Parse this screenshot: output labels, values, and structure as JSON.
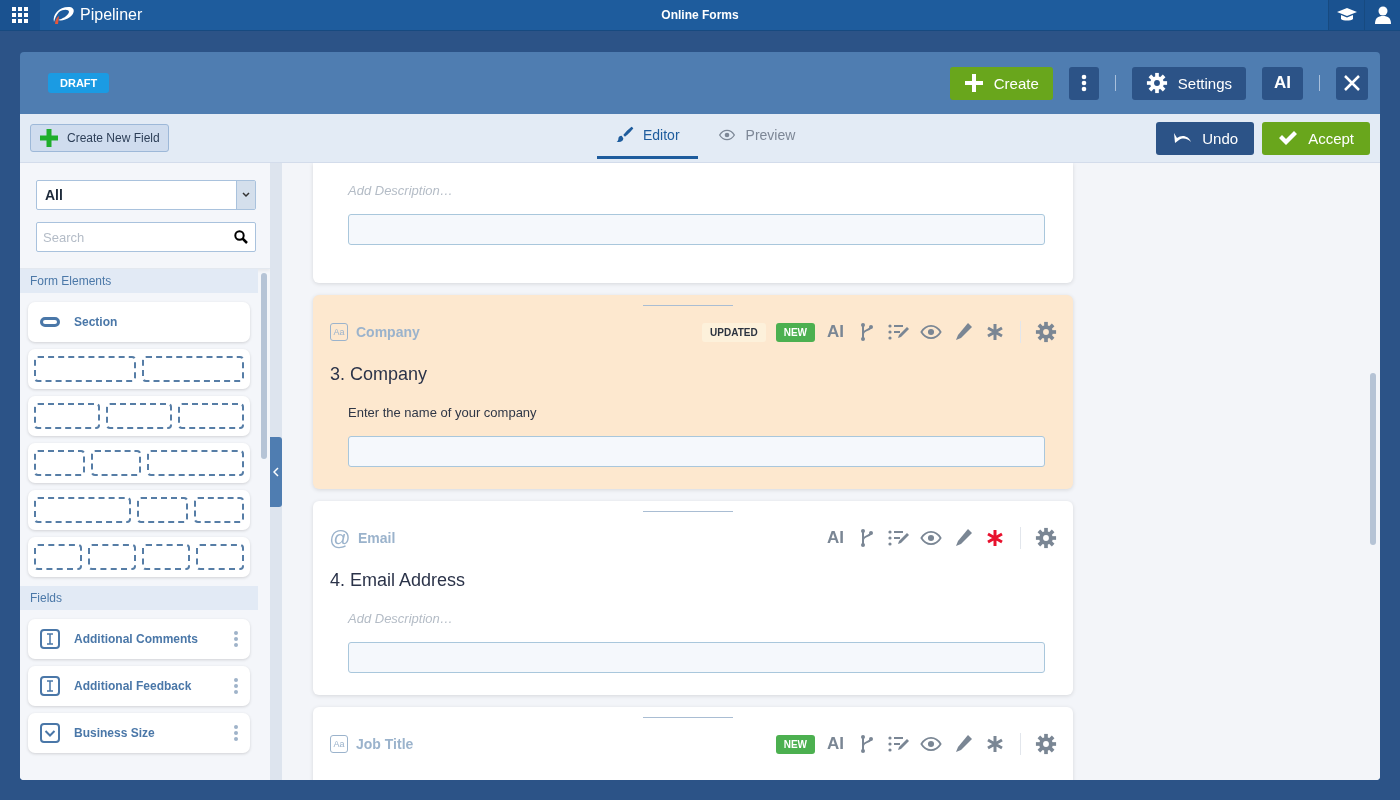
{
  "app_bar": {
    "brand": "Pipeliner",
    "title": "Online Forms"
  },
  "modal": {
    "status_badge": "DRAFT",
    "create": "Create",
    "settings": "Settings",
    "ai": "AI"
  },
  "toolbar": {
    "create_field": "Create New Field",
    "undo": "Undo",
    "accept": "Accept",
    "tabs": [
      {
        "label": "Editor",
        "selected": true
      },
      {
        "label": "Preview",
        "selected": false
      }
    ]
  },
  "sidebar": {
    "filter": {
      "value": "All"
    },
    "search": {
      "placeholder": "Search"
    },
    "groups": [
      {
        "title": "Form Elements",
        "items": [
          {
            "kind": "section",
            "label": "Section"
          },
          {
            "kind": "layout"
          },
          {
            "kind": "layout"
          },
          {
            "kind": "layout"
          },
          {
            "kind": "layout"
          },
          {
            "kind": "layout"
          }
        ]
      },
      {
        "title": "Fields",
        "items": [
          {
            "kind": "text",
            "label": "Additional Comments"
          },
          {
            "kind": "text",
            "label": "Additional Feedback"
          },
          {
            "kind": "dropdown",
            "label": "Business Size"
          }
        ]
      }
    ]
  },
  "questions": [
    {
      "selected": false,
      "description_placeholder": "Add Description…"
    },
    {
      "kind": "text",
      "type_icon": "Aa",
      "type_label": "Company",
      "selected": true,
      "badges": [
        {
          "kind": "updated",
          "text": "UPDATED"
        },
        {
          "kind": "new",
          "text": "NEW"
        }
      ],
      "ai_tool": "AI",
      "required": false,
      "title": "3. Company",
      "description": "Enter the name of your company"
    },
    {
      "kind": "email",
      "type_icon": "@",
      "type_label": "Email",
      "selected": false,
      "ai_tool": "AI",
      "required": true,
      "title": "4. Email Address",
      "description_placeholder": "Add Description…"
    },
    {
      "kind": "text",
      "type_icon": "Aa",
      "type_label": "Job Title",
      "selected": false,
      "badges": [
        {
          "kind": "new",
          "text": "NEW"
        }
      ],
      "ai_tool": "AI",
      "required": false
    }
  ]
}
